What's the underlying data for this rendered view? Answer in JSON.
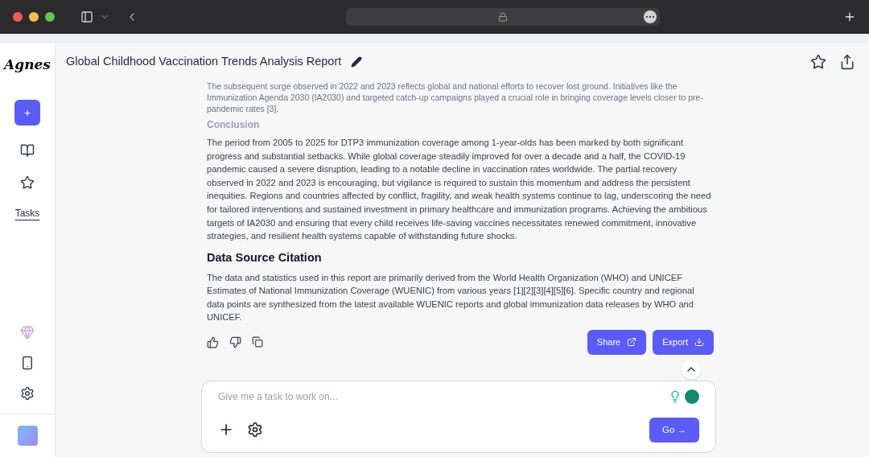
{
  "sidebar": {
    "logo": "Agnes",
    "new_button": "+",
    "tasks_link": "Tasks"
  },
  "header": {
    "title": "Global Childhood Vaccination Trends Analysis Report"
  },
  "report": {
    "faded_paragraph": "The subsequent surge observed in 2022 and 2023 reflects global and national efforts to recover lost ground. Initiatives like the Immunization Agenda 2030 (IA2030) and targeted catch-up campaigns played a crucial role in bringing coverage levels closer to pre-pandemic rates [3].",
    "sections": [
      {
        "kind": "minor",
        "heading": "Conclusion",
        "body": "The period from 2005 to 2025 for DTP3 immunization coverage among 1-year-olds has been marked by both significant progress and substantial setbacks. While global coverage steadily improved for over a decade and a half, the COVID-19 pandemic caused a severe disruption, leading to a notable decline in vaccination rates worldwide. The partial recovery observed in 2022 and 2023 is encouraging, but vigilance is required to sustain this momentum and address the persistent inequities. Regions and countries affected by conflict, fragility, and weak health systems continue to lag, underscoring the need for tailored interventions and sustained investment in primary healthcare and immunization programs. Achieving the ambitious targets of IA2030 and ensuring that every child receives life-saving vaccines necessitates renewed commitment, innovative strategies, and resilient health systems capable of withstanding future shocks."
      },
      {
        "kind": "major",
        "heading": "Data Source Citation",
        "body": "The data and statistics used in this report are primarily derived from the World Health Organization (WHO) and UNICEF Estimates of National Immunization Coverage (WUENIC) from various years [1][2][3][4][5][6]. Specific country and regional data points are synthesized from the latest available WUENIC reports and global immunization data releases by WHO and UNICEF."
      }
    ],
    "actions": [
      "Share",
      "Export"
    ]
  },
  "composer": {
    "placeholder": "Give me a task to work on...",
    "go_button": "Go →"
  }
}
